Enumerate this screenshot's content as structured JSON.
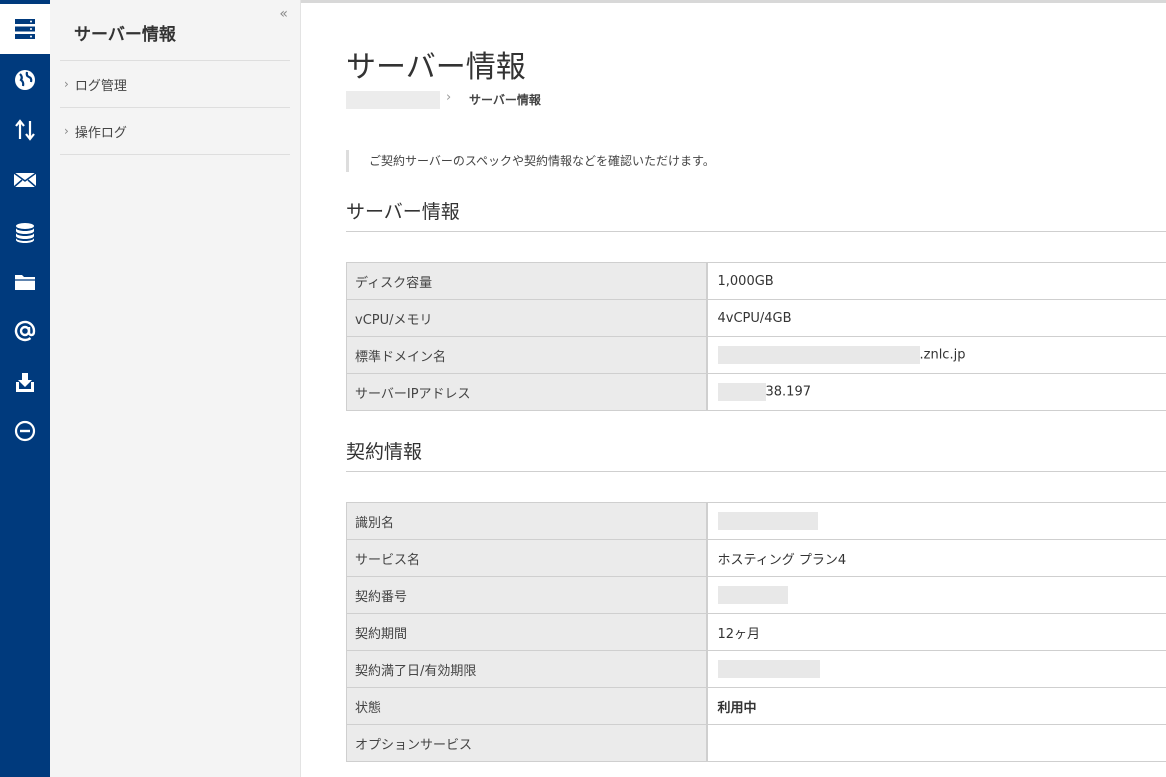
{
  "sidebar": {
    "title": "サーバー情報",
    "collapse_glyph": "«",
    "items": [
      {
        "label": "ログ管理"
      },
      {
        "label": "操作ログ"
      }
    ]
  },
  "rail": {
    "icons": [
      "server-icon",
      "globe-icon",
      "transfer-icon",
      "mail-icon",
      "database-icon",
      "folder-icon",
      "at-icon",
      "download-icon",
      "minus-circle-icon"
    ]
  },
  "main": {
    "title": "サーバー情報",
    "breadcrumb": {
      "current": "サーバー情報"
    },
    "notice": "ご契約サーバーのスペックや契約情報などを確認いただけます。",
    "server_section": {
      "title": "サーバー情報",
      "rows": [
        {
          "label": "ディスク容量",
          "value": "1,000GB"
        },
        {
          "label": "vCPU/メモリ",
          "value": "4vCPU/4GB"
        },
        {
          "label": "標準ドメイン名",
          "value": ".znlc.jp"
        },
        {
          "label": "サーバーIPアドレス",
          "value": "38.197"
        }
      ]
    },
    "contract_section": {
      "title": "契約情報",
      "rows": [
        {
          "label": "識別名",
          "value": ""
        },
        {
          "label": "サービス名",
          "value": "ホスティング プラン4"
        },
        {
          "label": "契約番号",
          "value": ""
        },
        {
          "label": "契約期間",
          "value": "12ヶ月"
        },
        {
          "label": "契約満了日/有効期限",
          "value": ""
        },
        {
          "label": "状態",
          "value": "利用中"
        },
        {
          "label": "オプションサービス",
          "value": ""
        }
      ]
    }
  },
  "colors": {
    "rail_bg": "#003a7d",
    "sidebar_bg": "#f4f4f4",
    "label_bg": "#ebebeb"
  }
}
